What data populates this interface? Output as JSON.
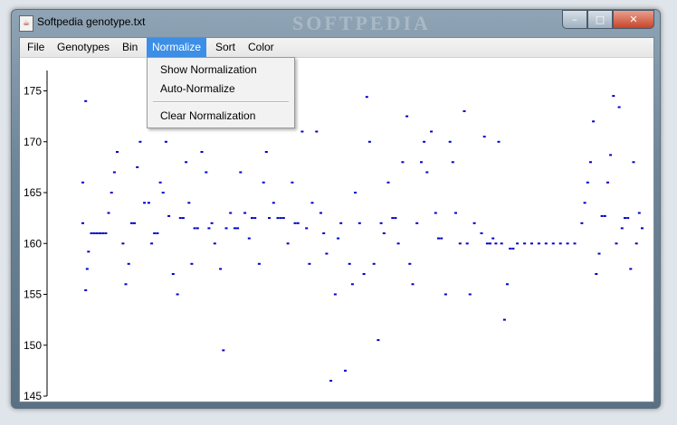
{
  "window": {
    "title": "Softpedia genotype.txt",
    "watermark": "SOFTPEDIA"
  },
  "controls": {
    "minimize": "–",
    "maximize": "□",
    "close": "✕"
  },
  "menubar": [
    "File",
    "Genotypes",
    "Bin",
    "Normalize",
    "Sort",
    "Color"
  ],
  "dropdown": {
    "items": [
      "Show Normalization",
      "Auto-Normalize"
    ],
    "after_separator": "Clear Normalization"
  },
  "colors": {
    "points": "#0000cc",
    "accent": "#3d8ee6"
  },
  "chart_data": {
    "type": "scatter",
    "ylim": [
      145,
      177
    ],
    "yticks": [
      "175",
      "170",
      "165",
      "160",
      "155",
      "150",
      "145"
    ],
    "points_color": "#0000cc",
    "series": [
      {
        "points": [
          [
            12,
            162
          ],
          [
            12,
            166
          ],
          [
            14,
            174
          ],
          [
            14,
            155.4
          ],
          [
            15,
            157.5
          ],
          [
            16,
            159.2
          ],
          [
            18,
            161
          ],
          [
            20,
            161
          ],
          [
            22,
            161
          ],
          [
            24,
            161
          ],
          [
            26,
            161
          ],
          [
            28,
            161
          ],
          [
            30,
            163
          ],
          [
            32,
            165
          ],
          [
            34,
            167
          ],
          [
            36,
            169
          ],
          [
            40,
            160
          ],
          [
            42,
            156
          ],
          [
            44,
            158
          ],
          [
            46,
            162
          ],
          [
            48,
            162
          ],
          [
            50,
            167.5
          ],
          [
            52,
            170
          ],
          [
            55,
            164
          ],
          [
            58,
            164
          ],
          [
            60,
            160
          ],
          [
            62,
            161
          ],
          [
            64,
            161
          ],
          [
            66,
            166
          ],
          [
            68,
            165
          ],
          [
            70,
            170
          ],
          [
            72,
            162.7
          ],
          [
            75,
            157
          ],
          [
            78,
            155
          ],
          [
            80,
            162.5
          ],
          [
            82,
            162.5
          ],
          [
            84,
            168
          ],
          [
            86,
            164
          ],
          [
            88,
            158
          ],
          [
            90,
            161.5
          ],
          [
            92,
            161.5
          ],
          [
            95,
            169
          ],
          [
            98,
            167
          ],
          [
            100,
            161.5
          ],
          [
            102,
            162
          ],
          [
            104,
            160
          ],
          [
            108,
            157.5
          ],
          [
            110,
            149.5
          ],
          [
            112,
            161.5
          ],
          [
            115,
            163
          ],
          [
            118,
            161.5
          ],
          [
            120,
            161.5
          ],
          [
            122,
            167
          ],
          [
            125,
            163
          ],
          [
            128,
            160.5
          ],
          [
            130,
            162.5
          ],
          [
            132,
            162.5
          ],
          [
            135,
            158
          ],
          [
            138,
            166
          ],
          [
            140,
            169
          ],
          [
            142,
            162.5
          ],
          [
            145,
            164
          ],
          [
            148,
            162.5
          ],
          [
            150,
            162.5
          ],
          [
            152,
            162.5
          ],
          [
            155,
            160
          ],
          [
            158,
            166
          ],
          [
            160,
            162
          ],
          [
            162,
            162
          ],
          [
            165,
            171
          ],
          [
            168,
            161.5
          ],
          [
            170,
            158
          ],
          [
            172,
            164
          ],
          [
            175,
            171
          ],
          [
            178,
            163
          ],
          [
            180,
            161
          ],
          [
            182,
            159
          ],
          [
            185,
            146.5
          ],
          [
            188,
            155
          ],
          [
            190,
            160.5
          ],
          [
            192,
            162
          ],
          [
            195,
            147.5
          ],
          [
            198,
            158
          ],
          [
            200,
            156
          ],
          [
            202,
            165
          ],
          [
            205,
            162
          ],
          [
            208,
            157
          ],
          [
            210,
            174.4
          ],
          [
            212,
            170
          ],
          [
            215,
            158
          ],
          [
            218,
            150.5
          ],
          [
            220,
            162
          ],
          [
            222,
            161
          ],
          [
            225,
            166
          ],
          [
            228,
            162.5
          ],
          [
            230,
            162.5
          ],
          [
            232,
            160
          ],
          [
            235,
            168
          ],
          [
            238,
            172.5
          ],
          [
            240,
            158
          ],
          [
            242,
            156
          ],
          [
            245,
            162
          ],
          [
            248,
            168
          ],
          [
            250,
            170
          ],
          [
            252,
            167
          ],
          [
            255,
            171
          ],
          [
            258,
            163
          ],
          [
            260,
            160.5
          ],
          [
            262,
            160.5
          ],
          [
            265,
            155
          ],
          [
            268,
            170
          ],
          [
            270,
            168
          ],
          [
            272,
            163
          ],
          [
            275,
            160
          ],
          [
            278,
            173
          ],
          [
            280,
            160
          ],
          [
            282,
            155
          ],
          [
            285,
            162
          ],
          [
            290,
            161
          ],
          [
            292,
            170.5
          ],
          [
            294,
            160
          ],
          [
            296,
            160
          ],
          [
            298,
            160.5
          ],
          [
            300,
            160
          ],
          [
            302,
            170
          ],
          [
            304,
            160
          ],
          [
            306,
            152.5
          ],
          [
            308,
            156
          ],
          [
            310,
            159.5
          ],
          [
            312,
            159.5
          ],
          [
            315,
            160
          ],
          [
            320,
            160
          ],
          [
            325,
            160
          ],
          [
            330,
            160
          ],
          [
            335,
            160
          ],
          [
            340,
            160
          ],
          [
            345,
            160
          ],
          [
            350,
            160
          ],
          [
            355,
            160
          ],
          [
            360,
            162
          ],
          [
            362,
            164
          ],
          [
            364,
            166
          ],
          [
            366,
            168
          ],
          [
            368,
            172
          ],
          [
            370,
            157
          ],
          [
            372,
            159
          ],
          [
            374,
            162.7
          ],
          [
            376,
            162.7
          ],
          [
            378,
            166
          ],
          [
            380,
            168.7
          ],
          [
            382,
            174.5
          ],
          [
            384,
            160
          ],
          [
            386,
            173.4
          ],
          [
            388,
            161.5
          ],
          [
            390,
            162.5
          ],
          [
            392,
            162.5
          ],
          [
            394,
            157.5
          ],
          [
            396,
            168
          ],
          [
            398,
            160
          ],
          [
            400,
            163
          ],
          [
            402,
            161.5
          ]
        ]
      }
    ]
  }
}
